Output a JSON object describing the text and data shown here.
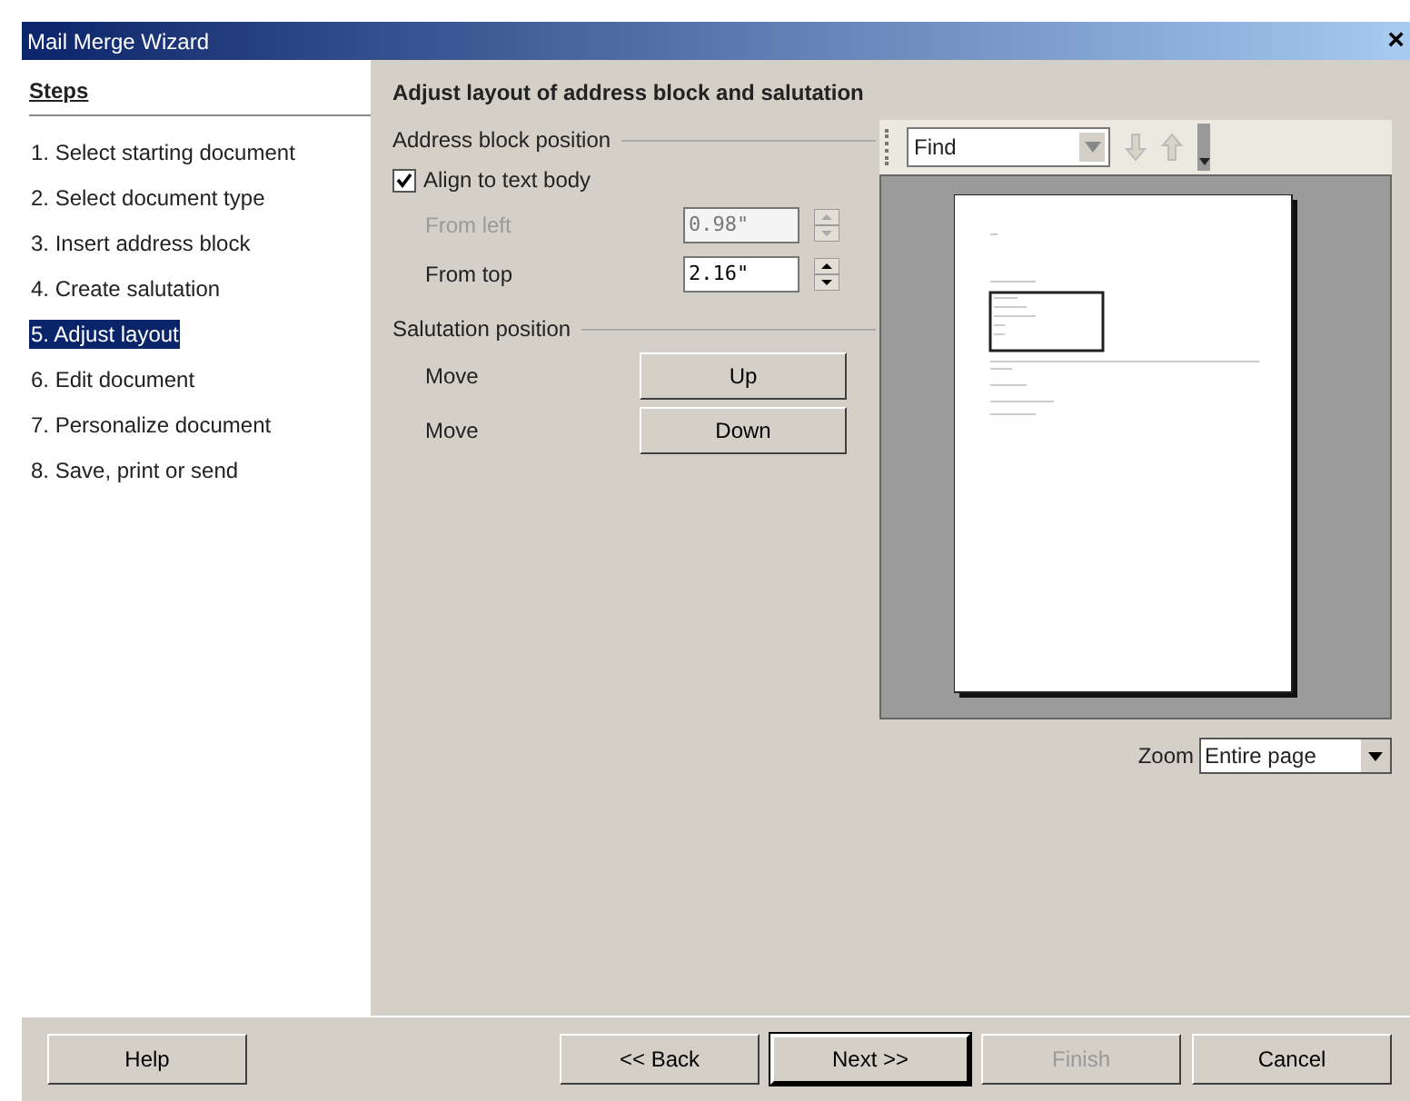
{
  "window": {
    "title": "Mail Merge Wizard",
    "close": "×"
  },
  "steps": {
    "heading": "Steps",
    "items": [
      {
        "label": "1. Select starting document",
        "selected": false
      },
      {
        "label": "2. Select document type",
        "selected": false
      },
      {
        "label": "3. Insert address block",
        "selected": false
      },
      {
        "label": "4. Create salutation",
        "selected": false
      },
      {
        "label": "5. Adjust layout",
        "selected": true
      },
      {
        "label": "6. Edit document",
        "selected": false
      },
      {
        "label": "7. Personalize document",
        "selected": false
      },
      {
        "label": "8. Save, print or send",
        "selected": false
      }
    ]
  },
  "page_title": "Adjust layout of address block and salutation",
  "address_block": {
    "heading": "Address block position",
    "align": {
      "label": "Align to text body",
      "checked": true
    },
    "fields": [
      {
        "label": "From left",
        "value": "0.98\"",
        "disabled": true
      },
      {
        "label": "From top",
        "value": "2.16\"",
        "disabled": false
      }
    ]
  },
  "salutation": {
    "heading": "Salutation position",
    "rows": [
      {
        "label": "Move",
        "button": "Up"
      },
      {
        "label": "Move",
        "button": "Down"
      }
    ]
  },
  "find_toolbar": {
    "value": "Find"
  },
  "zoom": {
    "label": "Zoom",
    "value": "Entire page"
  },
  "buttons": [
    {
      "label": "Help",
      "disabled": false,
      "default": false
    },
    {
      "label": "<< Back",
      "disabled": false,
      "default": false
    },
    {
      "label": "Next >>",
      "disabled": false,
      "default": true
    },
    {
      "label": "Finish",
      "disabled": true,
      "default": false
    },
    {
      "label": "Cancel",
      "disabled": false,
      "default": false
    }
  ]
}
